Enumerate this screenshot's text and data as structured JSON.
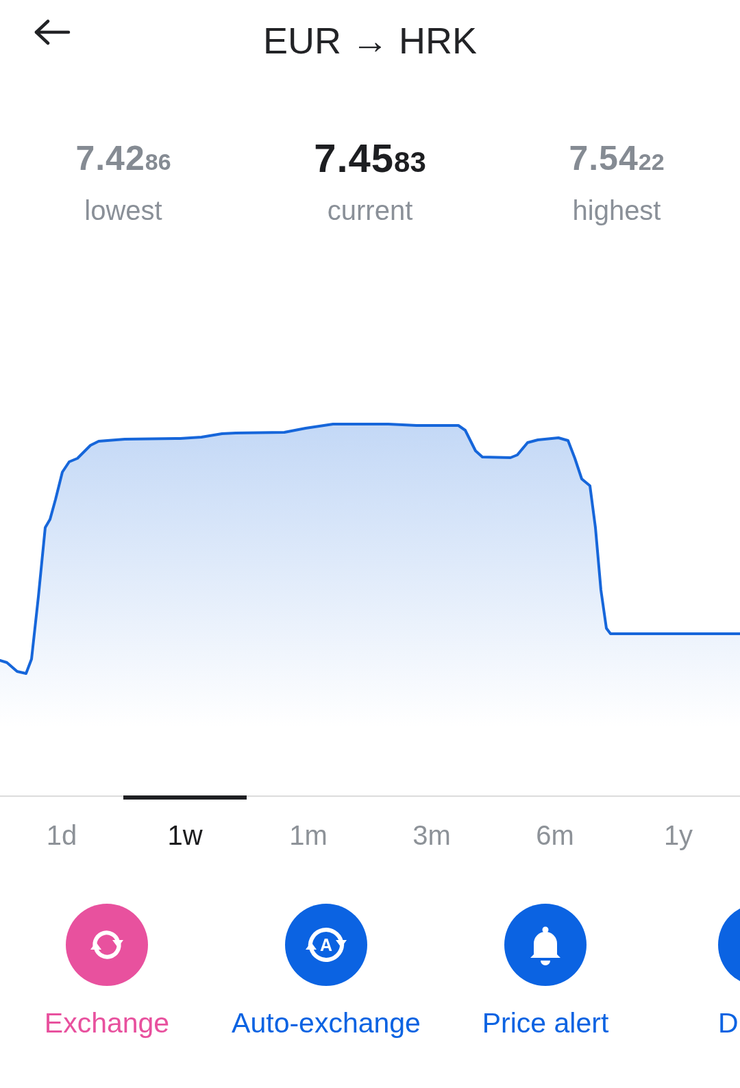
{
  "header": {
    "title": "EUR → HRK"
  },
  "stats": [
    {
      "value": "7.42",
      "small_digits": "86",
      "label": "lowest",
      "highlighted": false
    },
    {
      "value": "7.45",
      "small_digits": "83",
      "label": "current",
      "highlighted": true
    },
    {
      "value": "7.54",
      "small_digits": "22",
      "label": "highest",
      "highlighted": false
    }
  ],
  "tabs": [
    {
      "label": "1d",
      "selected": false
    },
    {
      "label": "1w",
      "selected": true
    },
    {
      "label": "1m",
      "selected": false
    },
    {
      "label": "3m",
      "selected": false
    },
    {
      "label": "6m",
      "selected": false
    },
    {
      "label": "1y",
      "selected": false
    }
  ],
  "actions": [
    {
      "kind": "exchange",
      "label": "Exchange",
      "color": "#e8519e"
    },
    {
      "kind": "auto_exchange",
      "label": "Auto-exchange",
      "icon_letter": "A",
      "color": "#0b63e2"
    },
    {
      "kind": "alert",
      "label": "Price alert",
      "color": "#0b63e2"
    },
    {
      "kind": "clipped",
      "label": "D",
      "color": "#0b63e2"
    }
  ]
}
